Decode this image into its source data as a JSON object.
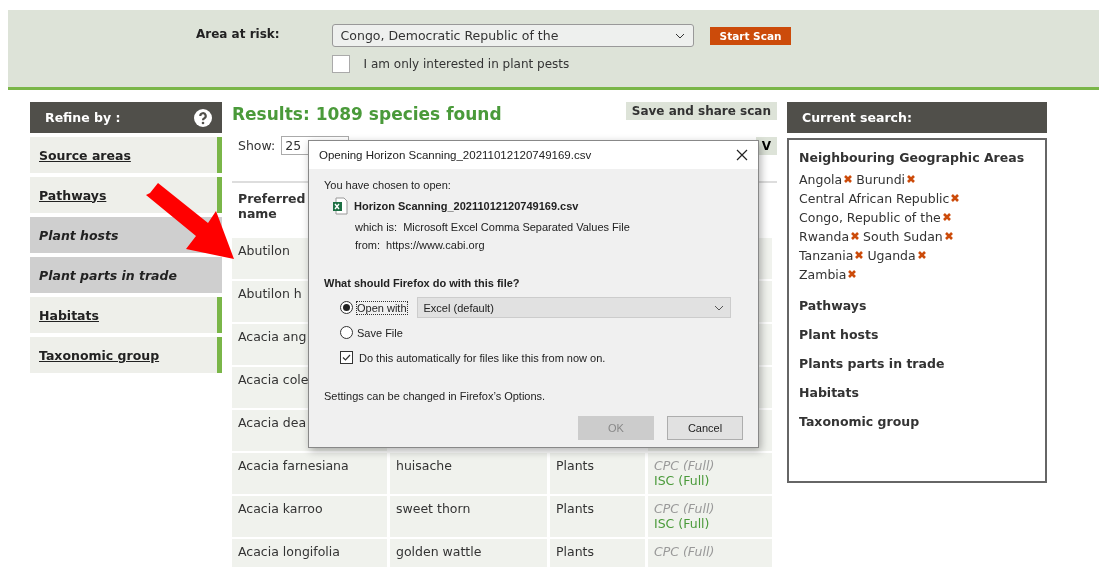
{
  "top_bar": {
    "area_label": "Area at risk:",
    "area_value": "Congo, Democratic Republic of the",
    "start_button": "Start Scan",
    "pests_only": {
      "label": "I am only interested in plant pests",
      "checked": false
    }
  },
  "refine": {
    "title": "Refine by :",
    "items": [
      {
        "label": "Source areas",
        "selected": false
      },
      {
        "label": "Pathways",
        "selected": false
      },
      {
        "label": "Plant hosts",
        "selected": true
      },
      {
        "label": "Plant parts in trade",
        "selected": true
      },
      {
        "label": "Habitats",
        "selected": false
      },
      {
        "label": "Taxonomic group",
        "selected": false
      }
    ]
  },
  "results": {
    "title": "Results: 1089 species found",
    "save_button": "Save and share scan",
    "show_label": "Show:",
    "show_value": "25",
    "csv_button": "V",
    "header": "Preferred name",
    "rows": [
      {
        "cells": [
          "Abutilon"
        ],
        "links": []
      },
      {
        "cells": [
          "Abutilon h"
        ],
        "links": []
      },
      {
        "cells": [
          "Acacia ang"
        ],
        "links": []
      },
      {
        "cells": [
          "Acacia cole"
        ],
        "links": []
      },
      {
        "cells": [
          "Acacia dea"
        ],
        "links": []
      },
      {
        "cells": [
          "Acacia farnesiana",
          "huisache",
          "Plants"
        ],
        "links": [
          {
            "label": "CPC (Full)",
            "available": false
          },
          {
            "label": "ISC (Full)",
            "available": true
          }
        ]
      },
      {
        "cells": [
          "Acacia karroo",
          "sweet thorn",
          "Plants"
        ],
        "links": [
          {
            "label": "CPC (Full)",
            "available": false
          },
          {
            "label": "ISC (Full)",
            "available": true
          }
        ]
      },
      {
        "cells": [
          "Acacia longifolia",
          "golden wattle",
          "Plants"
        ],
        "links": [
          {
            "label": "CPC (Full)",
            "available": false
          }
        ]
      }
    ]
  },
  "current_search": {
    "title": "Current search:",
    "heading": "Neighbouring Geographic Areas",
    "areas": [
      "Angola",
      "Burundi",
      "Central African Republic",
      "Congo, Republic of the",
      "Rwanda",
      "South Sudan",
      "Tanzania",
      "Uganda",
      "Zambia"
    ],
    "sections": [
      "Pathways",
      "Plant hosts",
      "Plants parts in trade",
      "Habitats",
      "Taxonomic group"
    ]
  },
  "dialog": {
    "title": "Opening Horizon Scanning_20211012120749169.csv",
    "intro": "You have chosen to open:",
    "file_name": "Horizon Scanning_20211012120749169.csv",
    "which_label": "which is:",
    "which_value": "Microsoft Excel Comma Separated Values File",
    "from_label": "from:",
    "from_value": "https://www.cabi.org",
    "question": "What should Firefox do with this file?",
    "options": [
      {
        "label": "Open with",
        "selected": true
      },
      {
        "label": "Save File",
        "selected": false
      }
    ],
    "app": "Excel (default)",
    "auto": {
      "label": "Do this automatically for files like this from now on.",
      "checked": true
    },
    "note": "Settings can be changed in Firefox’s Options.",
    "buttons": [
      {
        "label": "OK",
        "disabled": true
      },
      {
        "label": "Cancel",
        "disabled": false
      }
    ]
  }
}
